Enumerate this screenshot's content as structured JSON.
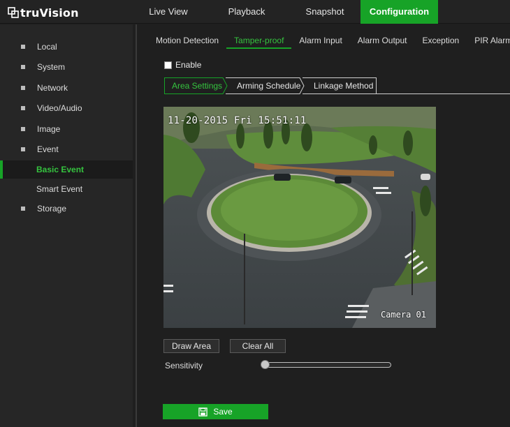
{
  "brand": {
    "name": "truVision"
  },
  "top_nav": {
    "tabs": [
      {
        "label": "Live View"
      },
      {
        "label": "Playback"
      },
      {
        "label": "Snapshot"
      },
      {
        "label": "Configuration"
      }
    ],
    "active": "Configuration"
  },
  "sidebar": {
    "items": [
      {
        "label": "Local"
      },
      {
        "label": "System"
      },
      {
        "label": "Network"
      },
      {
        "label": "Video/Audio"
      },
      {
        "label": "Image"
      },
      {
        "label": "Event"
      },
      {
        "label": "Basic Event"
      },
      {
        "label": "Smart Event"
      },
      {
        "label": "Storage"
      }
    ],
    "selected": "Basic Event"
  },
  "sub_nav": {
    "tabs": [
      {
        "label": "Motion Detection"
      },
      {
        "label": "Tamper-proof"
      },
      {
        "label": "Alarm Input"
      },
      {
        "label": "Alarm Output"
      },
      {
        "label": "Exception"
      },
      {
        "label": "PIR Alarm"
      }
    ],
    "active": "Tamper-proof"
  },
  "enable": {
    "label": "Enable",
    "checked": false
  },
  "steps": [
    {
      "label": "Area Settings"
    },
    {
      "label": "Arming Schedule"
    },
    {
      "label": "Linkage Method"
    }
  ],
  "active_step": "Area Settings",
  "video": {
    "osd_datetime": "11-20-2015  Fri 15:51:11",
    "osd_camera": "Camera 01"
  },
  "controls": {
    "draw_area": "Draw Area",
    "clear_all": "Clear All",
    "sensitivity_label": "Sensitivity",
    "sensitivity_level": 0
  },
  "save": {
    "label": "Save"
  },
  "colors": {
    "accent": "#17a327",
    "background": "#1f1f1f",
    "sidebar": "#262626"
  }
}
